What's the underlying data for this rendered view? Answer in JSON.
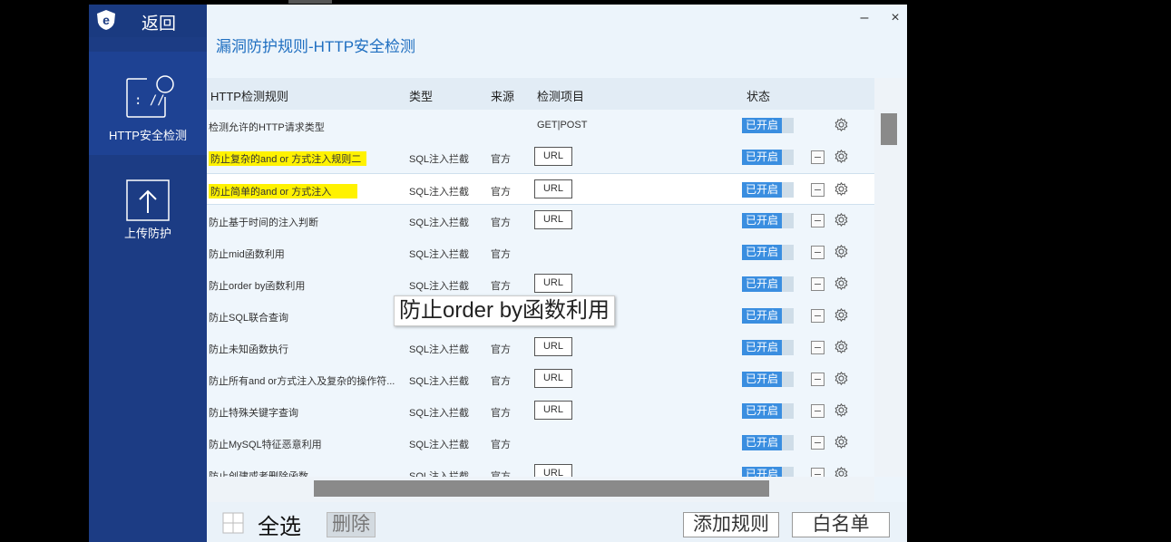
{
  "sidebar": {
    "back_label": "返回",
    "items": [
      {
        "label": "HTTP安全检测",
        "icon": "http-detect-icon"
      },
      {
        "label": "上传防护",
        "icon": "upload-icon"
      }
    ]
  },
  "window": {
    "title": "漏洞防护规则-HTTP安全检测",
    "minimize": "–",
    "close": "×"
  },
  "table": {
    "headers": {
      "rule": "HTTP检测规则",
      "type": "类型",
      "source": "来源",
      "item": "检测项目",
      "status": "状态"
    },
    "rows": [
      {
        "name": "检测允许的HTTP请求类型",
        "type": "",
        "source": "",
        "item": "GET|POST",
        "status": "已开启"
      },
      {
        "name": "防止复杂的and or 方式注入规则二",
        "type": "SQL注入拦截",
        "source": "官方",
        "item": "URL",
        "status": "已开启"
      },
      {
        "name": "防止简单的and or 方式注入",
        "type": "SQL注入拦截",
        "source": "官方",
        "item": "URL",
        "status": "已开启"
      },
      {
        "name": "防止基于时间的注入判断",
        "type": "SQL注入拦截",
        "source": "官方",
        "item": "URL",
        "status": "已开启"
      },
      {
        "name": "防止mid函数利用",
        "type": "SQL注入拦截",
        "source": "官方",
        "item": "",
        "status": "已开启"
      },
      {
        "name": "防止order by函数利用",
        "type": "SQL注入拦截",
        "source": "官方",
        "item": "URL",
        "status": "已开启"
      },
      {
        "name": "防止SQL联合查询",
        "type": "",
        "source": "",
        "item": "",
        "status": "已开启"
      },
      {
        "name": "防止未知函数执行",
        "type": "SQL注入拦截",
        "source": "官方",
        "item": "URL",
        "status": "已开启"
      },
      {
        "name": "防止所有and or方式注入及复杂的操作符...",
        "type": "SQL注入拦截",
        "source": "官方",
        "item": "URL",
        "status": "已开启"
      },
      {
        "name": "防止特殊关键字查询",
        "type": "SQL注入拦截",
        "source": "官方",
        "item": "URL",
        "status": "已开启"
      },
      {
        "name": "防止MySQL特征恶意利用",
        "type": "SQL注入拦截",
        "source": "官方",
        "item": "",
        "status": "已开启"
      },
      {
        "name": "防止创建或者删除函数",
        "type": "SQL注入拦截",
        "source": "官方",
        "item": "URL",
        "status": "已开启"
      }
    ]
  },
  "tooltip": "防止order by函数利用",
  "footer": {
    "select_all": "全选",
    "delete": "删除",
    "add_rule": "添加规则",
    "whitelist": "白名单"
  },
  "colors": {
    "sidebar": "#1c3c84",
    "accent": "#3a8ee0",
    "title": "#1e6ec0",
    "highlight": "#fff200"
  }
}
